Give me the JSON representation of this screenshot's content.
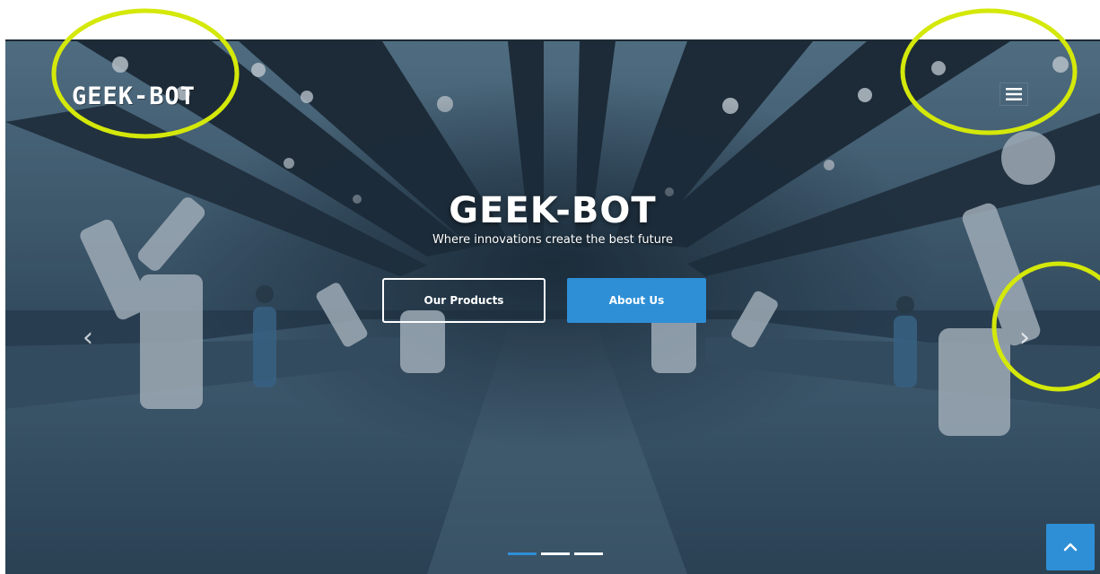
{
  "header": {
    "logo_text": "GEEK-BOT",
    "menu_icon": "hamburger-menu-icon"
  },
  "hero": {
    "title": "GEEK-BOT",
    "subtitle": "Where innovations create the best future",
    "primary_button": "Our Products",
    "secondary_button": "About Us"
  },
  "carousel": {
    "prev_icon": "chevron-left-icon",
    "next_icon": "chevron-right-icon",
    "prev_glyph": "‹",
    "next_glyph": "›",
    "slide_count": 3,
    "active_slide": 1
  },
  "back_to_top": {
    "icon": "chevron-up-icon"
  },
  "colors": {
    "accent": "#2e8fd6",
    "highlight_ring": "#d4e80a",
    "text": "#ffffff"
  }
}
